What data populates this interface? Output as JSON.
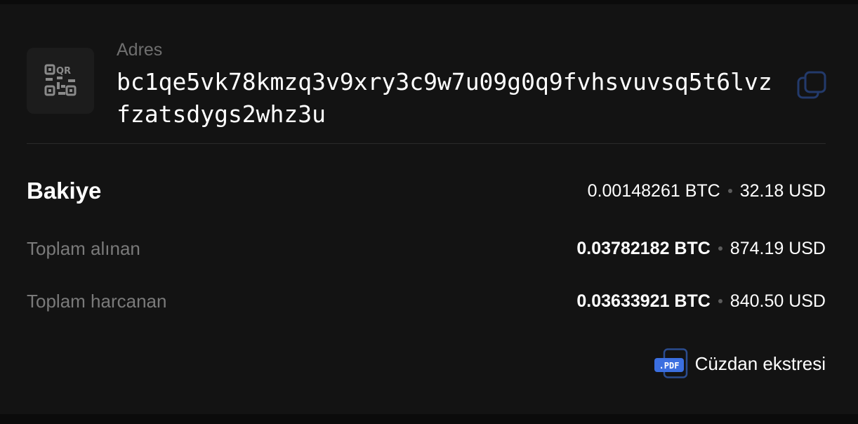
{
  "address": {
    "label": "Adres",
    "value": "bc1qe5vk78kmzq3v9xry3c9w7u09g0q9fvhsvuvsq5t6lvzfzatsdygs2whz3u",
    "qr_icon": "qr-code-icon",
    "copy_icon": "copy-icon"
  },
  "balance": {
    "label": "Bakiye",
    "btc": "0.00148261 BTC",
    "usd": "32.18 USD"
  },
  "total_received": {
    "label": "Toplam alınan",
    "btc": "0.03782182 BTC",
    "usd": "874.19 USD"
  },
  "total_spent": {
    "label": "Toplam harcanan",
    "btc": "0.03633921 BTC",
    "usd": "840.50 USD"
  },
  "statement": {
    "label": "Cüzdan ekstresi",
    "icon_text": ".PDF",
    "icon": "pdf-file-icon"
  },
  "colors": {
    "background": "#131313",
    "muted_text": "#7a7a7a",
    "pdf_accent": "#3b6fe0",
    "copy_icon": "#233a6b"
  }
}
